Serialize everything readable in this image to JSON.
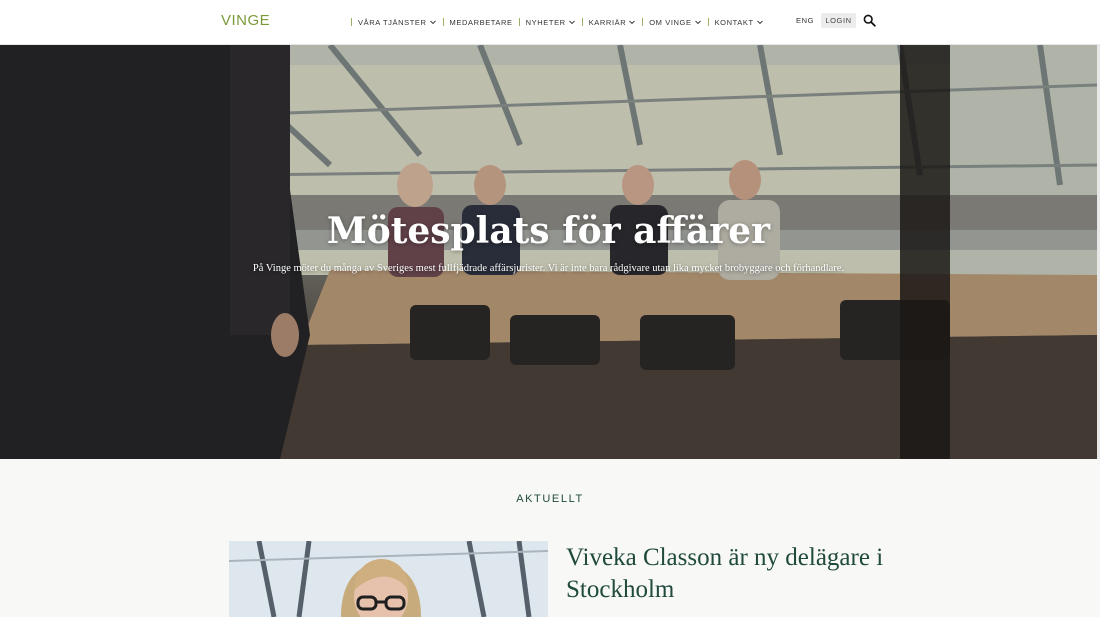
{
  "header": {
    "logo": "VINGE",
    "nav": [
      {
        "label": "VÅRA TJÄNSTER",
        "dropdown": true
      },
      {
        "label": "MEDARBETARE",
        "dropdown": false
      },
      {
        "label": "NYHETER",
        "dropdown": true
      },
      {
        "label": "KARRIÄR",
        "dropdown": true
      },
      {
        "label": "OM VINGE",
        "dropdown": true
      },
      {
        "label": "KONTAKT",
        "dropdown": true
      }
    ],
    "lang": "ENG",
    "login": "LOGIN",
    "search_icon": "search-icon"
  },
  "hero": {
    "title": "Mötesplats för affärer",
    "subtitle": "På Vinge möter du många av Sveriges mest fullfjädrade affärsjurister. Vi är inte bara rådgivare utan lika mycket brobyggare och förhandlare."
  },
  "news": {
    "section_label": "AKTUELLT",
    "item_title": "Viveka Classon är ny delägare i Stockholm"
  },
  "colors": {
    "brand_green": "#7a9a3a",
    "heading_green": "#1f4a3c"
  }
}
